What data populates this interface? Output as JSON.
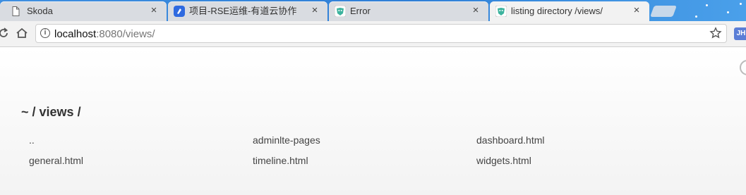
{
  "tabs": [
    {
      "title": "Skoda",
      "close": "×",
      "favicon": "document-icon"
    },
    {
      "title": "项目-RSE运维-有道云协作",
      "close": "×",
      "favicon": "youdao-icon"
    },
    {
      "title": "Error",
      "close": "×",
      "favicon": "express-icon"
    },
    {
      "title": "listing directory /views/",
      "close": "×",
      "favicon": "express-icon",
      "active": true
    }
  ],
  "toolbar": {
    "url_host": "localhost",
    "url_rest": ":8080/views/",
    "extension_label": "JH"
  },
  "page": {
    "breadcrumb": {
      "root": "~",
      "sep1": " / ",
      "dir": "views",
      "sep2": " /"
    },
    "files": [
      "..",
      "adminlte-pages",
      "dashboard.html",
      "general.html",
      "timeline.html",
      "widgets.html"
    ]
  },
  "colors": {
    "tabstrip": "#3f8fe0",
    "tab": "#d9dce1",
    "active_tab": "#f2f2f2",
    "toolbar": "#f2f2f2",
    "text": "#444444",
    "youdao": "#2f6ae0",
    "express": "#3db39e"
  }
}
